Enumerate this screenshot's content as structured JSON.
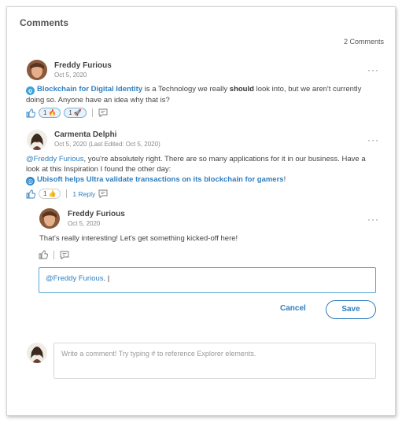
{
  "panel": {
    "title": "Comments",
    "count": "2 Comments"
  },
  "comments": [
    {
      "author": "Freddy Furious",
      "date": "Oct 5, 2020",
      "link": "Blockchain for Digital Identity",
      "text_1": " is a Technology we really ",
      "bold": "should",
      "text_2": " look into, but we aren't currently doing so. Anyone have an idea why that is?",
      "reactions": [
        {
          "count": "1",
          "emoji": "🔥"
        },
        {
          "count": "1",
          "emoji": "🚀"
        }
      ]
    },
    {
      "author": "Carmenta Delphi",
      "date": "Oct 5, 2020 (Last Edited: Oct 5, 2020)",
      "mention": "@Freddy Furious",
      "text_1": ", you're absolutely right. There are so many applications for it in our business. Have a look at this Inspiration I found the other day:",
      "link": "Ubisoft helps Ultra validate transactions on its blockchain for gamers",
      "link_suffix": "!",
      "reactions": [
        {
          "count": "1",
          "emoji": "👍"
        }
      ],
      "reply_label": "1 Reply"
    },
    {
      "author": "Freddy Furious",
      "date": "Oct 5, 2020",
      "text": "That's really interesting! Let's get something kicked-off here!"
    }
  ],
  "editor": {
    "value_mention": "@Freddy Furious",
    "value_suffix": ". |"
  },
  "buttons": {
    "cancel": "Cancel",
    "save": "Save"
  },
  "new_comment": {
    "placeholder": "Write a comment! Try typing # to reference Explorer elements."
  },
  "icons": {
    "more": "···",
    "explorer_icon": "ǫ",
    "inspiration_icon": "◎"
  }
}
